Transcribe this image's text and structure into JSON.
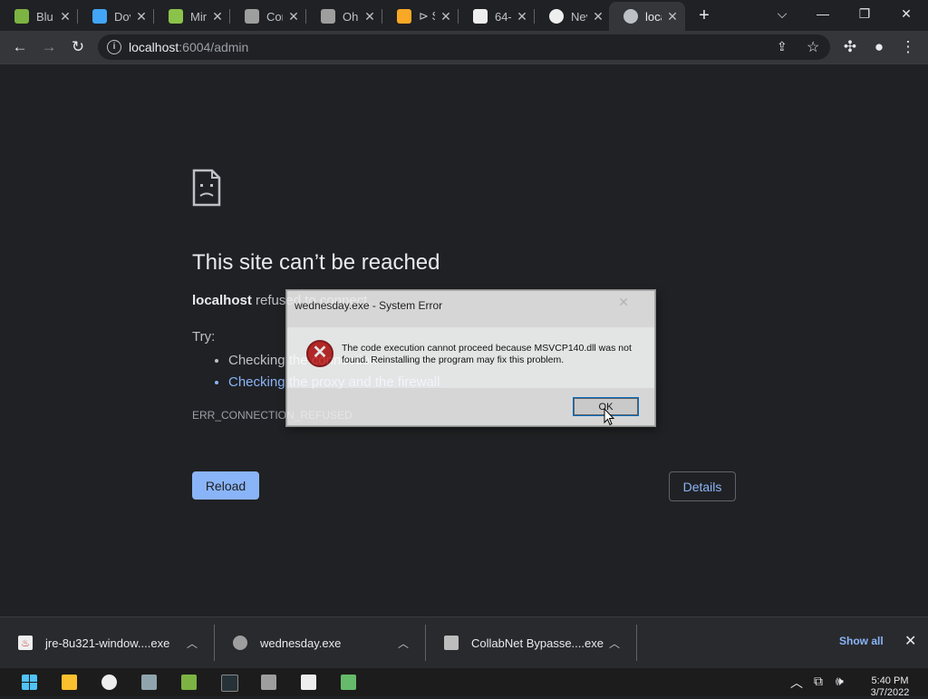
{
  "tabs": [
    {
      "title": "Blu",
      "icon": "bluestacks-icon",
      "color": "#7cb342"
    },
    {
      "title": "Dov",
      "icon": "download-icon",
      "color": "#42a5f5"
    },
    {
      "title": "Mir",
      "icon": "android-icon",
      "color": "#8bc34a"
    },
    {
      "title": "Cor",
      "icon": "app-icon",
      "color": "#9e9e9e"
    },
    {
      "title": "Oh",
      "icon": "app-icon",
      "color": "#9e9e9e"
    },
    {
      "title": "⊳ S",
      "icon": "box-icon",
      "color": "#f9a825"
    },
    {
      "title": "64-",
      "icon": "java-icon",
      "color": "#eeeeee"
    },
    {
      "title": "Nev",
      "icon": "chrome-icon",
      "color": "#eeeeee"
    },
    {
      "title": "loca",
      "icon": "globe-icon",
      "color": "#bdc1c6",
      "active": true
    }
  ],
  "address": {
    "host": "localhost",
    "rest": ":6004/admin"
  },
  "error": {
    "title": "This site can’t be reached",
    "host": "localhost",
    "host_suffix": " refused to connect.",
    "try": "Try:",
    "suggestions": [
      "Checking the connection",
      "Checking the proxy and the firewall"
    ],
    "code": "ERR_CONNECTION_REFUSED",
    "reload": "Reload",
    "details": "Details"
  },
  "dialog": {
    "title": "wednesday.exe - System Error",
    "message": "The code execution cannot proceed because MSVCP140.dll was not found. Reinstalling the program may fix this problem.",
    "ok": "OK"
  },
  "downloads": [
    {
      "name": "jre-8u321-window....exe"
    },
    {
      "name": "wednesday.exe"
    },
    {
      "name": "CollabNet Bypasse....exe"
    }
  ],
  "shelf": {
    "show_all": "Show all"
  },
  "clock": {
    "time": "5:40 PM",
    "date": "3/7/2022"
  }
}
